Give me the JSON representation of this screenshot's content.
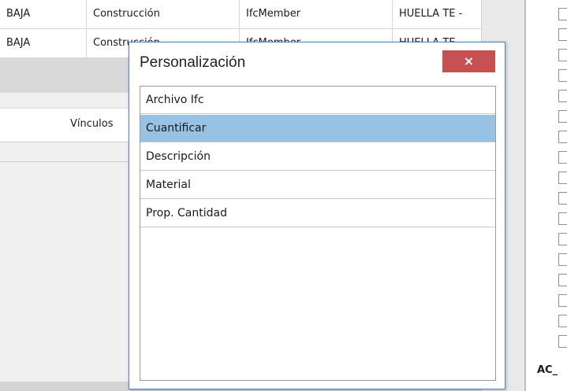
{
  "background_table": {
    "rows": [
      [
        "BAJA",
        "Construcción",
        "IfcMember",
        "HUELLA TE -"
      ],
      [
        "BAJA",
        "Construcción",
        "IfcMember",
        "HUELLA TE -"
      ]
    ]
  },
  "lower_panel": {
    "tab_label": "Vínculos"
  },
  "right_panel": {
    "label": "AC_"
  },
  "dialog": {
    "title": "Personalización",
    "close_glyph": "×",
    "items": [
      "Archivo Ifc",
      "Cuantificar",
      "Descripción",
      "Material",
      "Prop. Cantidad"
    ],
    "selected_item": "Cuantificar"
  },
  "colors": {
    "selection": "#98c2e3",
    "close_button": "#c75050",
    "dialog_border": "#4a86c8"
  }
}
